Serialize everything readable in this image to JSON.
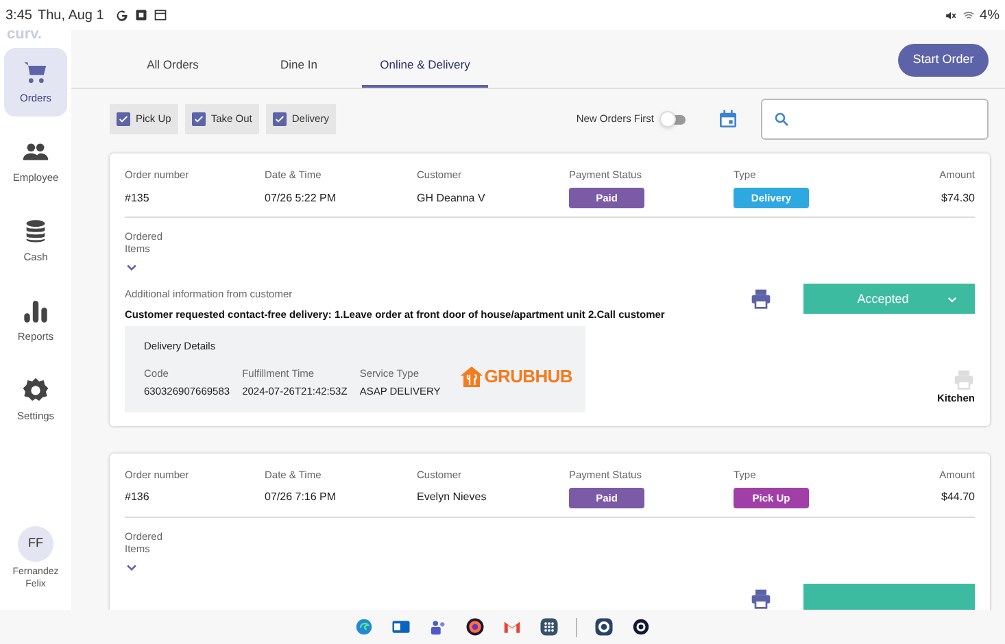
{
  "status_bar": {
    "time": "3:45",
    "date": "Thu, Aug 1",
    "battery": "4%"
  },
  "sidebar": {
    "logo": "curv.",
    "items": [
      {
        "label": "Orders",
        "kind": "cart",
        "selected": true
      },
      {
        "label": "Employee",
        "kind": "people",
        "selected": false
      },
      {
        "label": "Cash",
        "kind": "coins",
        "selected": false
      },
      {
        "label": "Reports",
        "kind": "bars",
        "selected": false
      },
      {
        "label": "Settings",
        "kind": "gear",
        "selected": false
      }
    ],
    "user": {
      "initials": "FF",
      "name": "Fernandez Felix"
    }
  },
  "tabs": [
    {
      "label": "All Orders",
      "selected": false
    },
    {
      "label": "Dine In",
      "selected": false
    },
    {
      "label": "Online & Delivery",
      "selected": true
    }
  ],
  "start_order_button": "Start Order",
  "filters": [
    {
      "label": "Pick Up",
      "checked": true
    },
    {
      "label": "Take Out",
      "checked": true
    },
    {
      "label": "Delivery",
      "checked": true
    }
  ],
  "sort_toggle": {
    "label": "New Orders First",
    "on": false
  },
  "orders": [
    {
      "fields": [
        {
          "label": "Order number",
          "value": "#135",
          "kind": "text"
        },
        {
          "label": "Date & Time",
          "value": "07/26 5:22 PM",
          "kind": "text"
        },
        {
          "label": "Customer",
          "value": "GH Deanna V",
          "kind": "text"
        },
        {
          "label": "Payment Status",
          "value": "Paid",
          "kind": "badge",
          "color": "#7b5aa6"
        },
        {
          "label": "Type",
          "value": "Delivery",
          "kind": "badge",
          "color": "#2ea8e0"
        },
        {
          "label": "Amount",
          "value": "$74.30",
          "kind": "amount"
        }
      ],
      "ordered_items_label": "Ordered Items",
      "info_label": "Additional information from customer",
      "info_text": "Customer requested contact-free delivery: 1.Leave order at front door of house/apartment unit 2.Call customer",
      "delivery": {
        "title": "Delivery Details",
        "fields": [
          {
            "label": "Code",
            "value": "630326907669583"
          },
          {
            "label": "Fulfillment Time",
            "value": "2024-07-26T21:42:53Z"
          },
          {
            "label": "Service Type",
            "value": "ASAP DELIVERY"
          }
        ],
        "partner": "GRUBHUB"
      },
      "status": "Accepted",
      "kitchen": "Kitchen"
    },
    {
      "fields": [
        {
          "label": "Order number",
          "value": "#136",
          "kind": "text"
        },
        {
          "label": "Date & Time",
          "value": "07/26 7:16 PM",
          "kind": "text"
        },
        {
          "label": "Customer",
          "value": "Evelyn Nieves",
          "kind": "text"
        },
        {
          "label": "Payment Status",
          "value": "Paid",
          "kind": "badge",
          "color": "#7b5aa6"
        },
        {
          "label": "Type",
          "value": "Pick Up",
          "kind": "badge",
          "color": "#a23ea8"
        },
        {
          "label": "Amount",
          "value": "$44.70",
          "kind": "amount"
        }
      ],
      "ordered_items_label": "Ordered Items"
    }
  ]
}
